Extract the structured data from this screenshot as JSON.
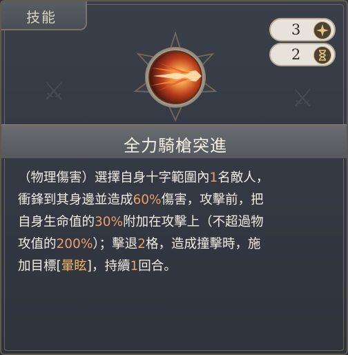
{
  "tab": {
    "label": "技能"
  },
  "skill": {
    "name": "全力騎槍突進",
    "cost": "3",
    "cooldown": "2"
  },
  "description": {
    "lines": [
      [
        {
          "t": "（物理傷害）選擇自身十字範圍內"
        },
        {
          "t": "1",
          "c": "hl"
        },
        {
          "t": "名敵人，"
        }
      ],
      [
        {
          "t": "衝鋒到其身邊並造成"
        },
        {
          "t": "60%",
          "c": "hl"
        },
        {
          "t": "傷害，攻擊前，把"
        }
      ],
      [
        {
          "t": "自身生命值的"
        },
        {
          "t": "30%",
          "c": "hl"
        },
        {
          "t": "附加在攻擊上（不超過物"
        }
      ],
      [
        {
          "t": "攻值的"
        },
        {
          "t": "200%",
          "c": "hl"
        },
        {
          "t": "）；擊退"
        },
        {
          "t": "2",
          "c": "hl"
        },
        {
          "t": "格，造成撞擊時，施"
        }
      ],
      [
        {
          "t": "加目標["
        },
        {
          "t": "暈眩",
          "c": "kw"
        },
        {
          "t": "]，持續"
        },
        {
          "t": "1",
          "c": "hl"
        },
        {
          "t": "回合。"
        }
      ]
    ]
  },
  "icons": {
    "skill_icon": "lance-charge-icon",
    "cost_icon": "star-icon",
    "cooldown_icon": "hourglass-icon"
  },
  "colors": {
    "highlight": "#e9a06a",
    "keyword": "#f2b562",
    "text": "#f1ede4"
  }
}
